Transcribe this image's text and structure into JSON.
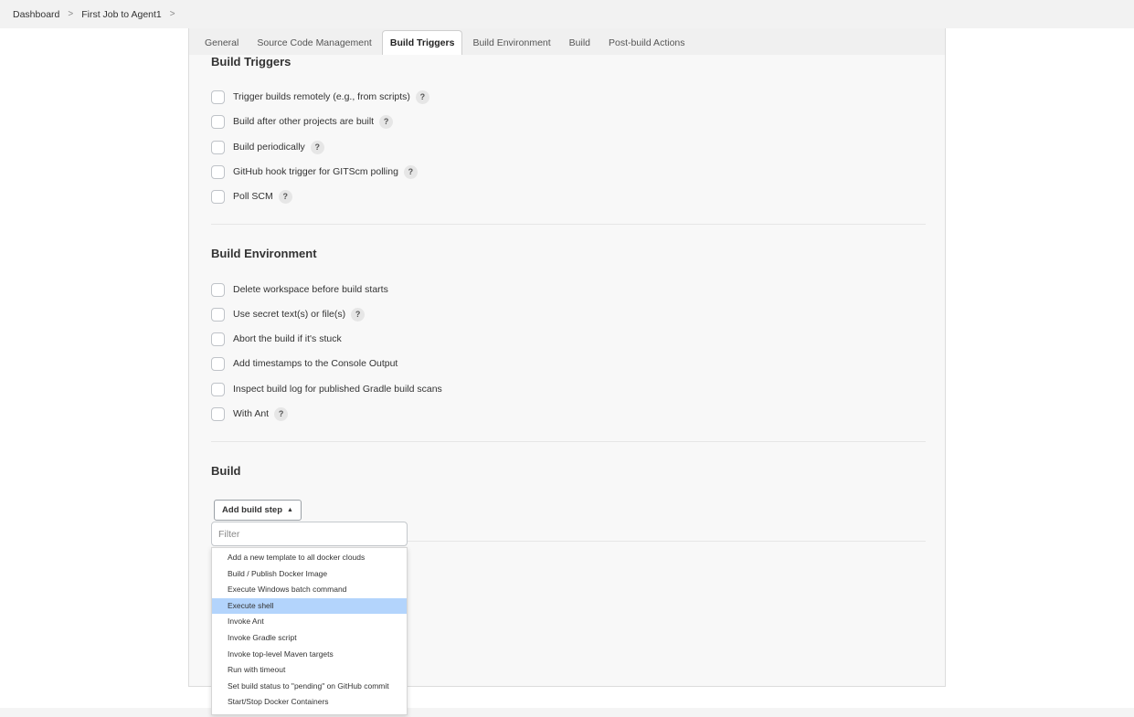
{
  "breadcrumb": {
    "items": [
      "Dashboard",
      "First Job to Agent1"
    ],
    "separator": ">"
  },
  "tabs": [
    {
      "label": "General",
      "active": false
    },
    {
      "label": "Source Code Management",
      "active": false
    },
    {
      "label": "Build Triggers",
      "active": true
    },
    {
      "label": "Build Environment",
      "active": false
    },
    {
      "label": "Build",
      "active": false
    },
    {
      "label": "Post-build Actions",
      "active": false
    }
  ],
  "build_triggers": {
    "title": "Build Triggers",
    "options": [
      {
        "label": "Trigger builds remotely (e.g., from scripts)",
        "checked": false,
        "help": true
      },
      {
        "label": "Build after other projects are built",
        "checked": false,
        "help": true
      },
      {
        "label": "Build periodically",
        "checked": false,
        "help": true
      },
      {
        "label": "GitHub hook trigger for GITScm polling",
        "checked": false,
        "help": true
      },
      {
        "label": "Poll SCM",
        "checked": false,
        "help": true
      }
    ]
  },
  "build_environment": {
    "title": "Build Environment",
    "options": [
      {
        "label": "Delete workspace before build starts",
        "checked": false,
        "help": false
      },
      {
        "label": "Use secret text(s) or file(s)",
        "checked": false,
        "help": true
      },
      {
        "label": "Abort the build if it's stuck",
        "checked": false,
        "help": false
      },
      {
        "label": "Add timestamps to the Console Output",
        "checked": false,
        "help": false
      },
      {
        "label": "Inspect build log for published Gradle build scans",
        "checked": false,
        "help": false
      },
      {
        "label": "With Ant",
        "checked": false,
        "help": true
      }
    ]
  },
  "build": {
    "title": "Build",
    "add_step_label": "Add build step",
    "caret": "▲",
    "filter_placeholder": "Filter",
    "filter_value": "",
    "menu_items": [
      "Add a new template to all docker clouds",
      "Build / Publish Docker Image",
      "Execute Windows batch command",
      "Execute shell",
      "Invoke Ant",
      "Invoke Gradle script",
      "Invoke top-level Maven targets",
      "Run with timeout",
      "Set build status to \"pending\" on GitHub commit",
      "Start/Stop Docker Containers"
    ],
    "highlighted_item": "Execute shell"
  },
  "help_glyph": "?",
  "colors": {
    "highlight": "#b3d4fc",
    "panel_bg": "#f8f8f8",
    "tabbar_bg": "#f0f0f0"
  }
}
